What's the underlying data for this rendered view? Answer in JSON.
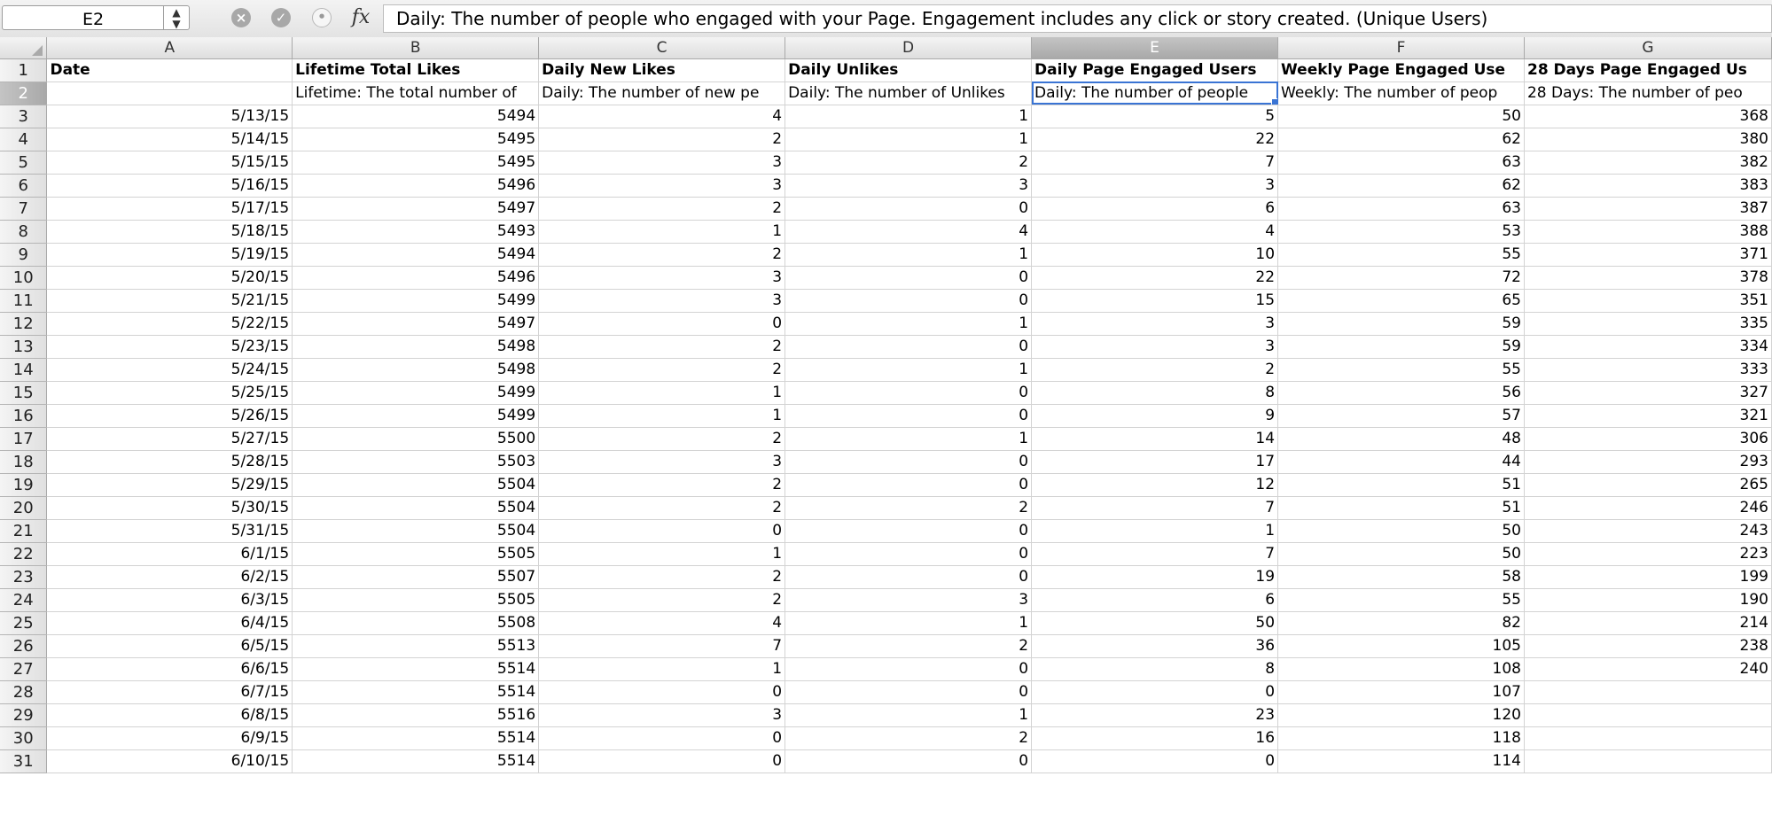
{
  "formula_bar": {
    "cell_ref": "E2",
    "fx_label": "fx",
    "content": "Daily: The number of people who engaged with your Page. Engagement includes any click or story created. (Unique Users)"
  },
  "columns": [
    "A",
    "B",
    "C",
    "D",
    "E",
    "F",
    "G"
  ],
  "selected_column": "E",
  "selected_row": 2,
  "header_row": [
    "Date",
    "Lifetime Total Likes",
    "Daily New Likes",
    "Daily Unlikes",
    "Daily Page Engaged Users",
    "Weekly Page Engaged Use",
    "28 Days Page Engaged Us"
  ],
  "description_row": [
    "",
    "Lifetime: The total number of",
    "Daily: The number of new pe",
    "Daily: The number of Unlikes",
    "Daily: The number of people",
    "Weekly: The number of peop",
    "28 Days: The number of peo"
  ],
  "rows": [
    {
      "n": 3,
      "date": "5/13/15",
      "b": "5494",
      "c": "4",
      "d": "1",
      "e": "5",
      "f": "50",
      "g": "368"
    },
    {
      "n": 4,
      "date": "5/14/15",
      "b": "5495",
      "c": "2",
      "d": "1",
      "e": "22",
      "f": "62",
      "g": "380"
    },
    {
      "n": 5,
      "date": "5/15/15",
      "b": "5495",
      "c": "3",
      "d": "2",
      "e": "7",
      "f": "63",
      "g": "382"
    },
    {
      "n": 6,
      "date": "5/16/15",
      "b": "5496",
      "c": "3",
      "d": "3",
      "e": "3",
      "f": "62",
      "g": "383"
    },
    {
      "n": 7,
      "date": "5/17/15",
      "b": "5497",
      "c": "2",
      "d": "0",
      "e": "6",
      "f": "63",
      "g": "387"
    },
    {
      "n": 8,
      "date": "5/18/15",
      "b": "5493",
      "c": "1",
      "d": "4",
      "e": "4",
      "f": "53",
      "g": "388"
    },
    {
      "n": 9,
      "date": "5/19/15",
      "b": "5494",
      "c": "2",
      "d": "1",
      "e": "10",
      "f": "55",
      "g": "371"
    },
    {
      "n": 10,
      "date": "5/20/15",
      "b": "5496",
      "c": "3",
      "d": "0",
      "e": "22",
      "f": "72",
      "g": "378"
    },
    {
      "n": 11,
      "date": "5/21/15",
      "b": "5499",
      "c": "3",
      "d": "0",
      "e": "15",
      "f": "65",
      "g": "351"
    },
    {
      "n": 12,
      "date": "5/22/15",
      "b": "5497",
      "c": "0",
      "d": "1",
      "e": "3",
      "f": "59",
      "g": "335"
    },
    {
      "n": 13,
      "date": "5/23/15",
      "b": "5498",
      "c": "2",
      "d": "0",
      "e": "3",
      "f": "59",
      "g": "334"
    },
    {
      "n": 14,
      "date": "5/24/15",
      "b": "5498",
      "c": "2",
      "d": "1",
      "e": "2",
      "f": "55",
      "g": "333"
    },
    {
      "n": 15,
      "date": "5/25/15",
      "b": "5499",
      "c": "1",
      "d": "0",
      "e": "8",
      "f": "56",
      "g": "327"
    },
    {
      "n": 16,
      "date": "5/26/15",
      "b": "5499",
      "c": "1",
      "d": "0",
      "e": "9",
      "f": "57",
      "g": "321"
    },
    {
      "n": 17,
      "date": "5/27/15",
      "b": "5500",
      "c": "2",
      "d": "1",
      "e": "14",
      "f": "48",
      "g": "306"
    },
    {
      "n": 18,
      "date": "5/28/15",
      "b": "5503",
      "c": "3",
      "d": "0",
      "e": "17",
      "f": "44",
      "g": "293"
    },
    {
      "n": 19,
      "date": "5/29/15",
      "b": "5504",
      "c": "2",
      "d": "0",
      "e": "12",
      "f": "51",
      "g": "265"
    },
    {
      "n": 20,
      "date": "5/30/15",
      "b": "5504",
      "c": "2",
      "d": "2",
      "e": "7",
      "f": "51",
      "g": "246"
    },
    {
      "n": 21,
      "date": "5/31/15",
      "b": "5504",
      "c": "0",
      "d": "0",
      "e": "1",
      "f": "50",
      "g": "243"
    },
    {
      "n": 22,
      "date": "6/1/15",
      "b": "5505",
      "c": "1",
      "d": "0",
      "e": "7",
      "f": "50",
      "g": "223"
    },
    {
      "n": 23,
      "date": "6/2/15",
      "b": "5507",
      "c": "2",
      "d": "0",
      "e": "19",
      "f": "58",
      "g": "199"
    },
    {
      "n": 24,
      "date": "6/3/15",
      "b": "5505",
      "c": "2",
      "d": "3",
      "e": "6",
      "f": "55",
      "g": "190"
    },
    {
      "n": 25,
      "date": "6/4/15",
      "b": "5508",
      "c": "4",
      "d": "1",
      "e": "50",
      "f": "82",
      "g": "214"
    },
    {
      "n": 26,
      "date": "6/5/15",
      "b": "5513",
      "c": "7",
      "d": "2",
      "e": "36",
      "f": "105",
      "g": "238"
    },
    {
      "n": 27,
      "date": "6/6/15",
      "b": "5514",
      "c": "1",
      "d": "0",
      "e": "8",
      "f": "108",
      "g": "240"
    },
    {
      "n": 28,
      "date": "6/7/15",
      "b": "5514",
      "c": "0",
      "d": "0",
      "e": "0",
      "f": "107",
      "g": ""
    },
    {
      "n": 29,
      "date": "6/8/15",
      "b": "5516",
      "c": "3",
      "d": "1",
      "e": "23",
      "f": "120",
      "g": ""
    },
    {
      "n": 30,
      "date": "6/9/15",
      "b": "5514",
      "c": "0",
      "d": "2",
      "e": "16",
      "f": "118",
      "g": ""
    },
    {
      "n": 31,
      "date": "6/10/15",
      "b": "5514",
      "c": "0",
      "d": "0",
      "e": "0",
      "f": "114",
      "g": ""
    }
  ]
}
